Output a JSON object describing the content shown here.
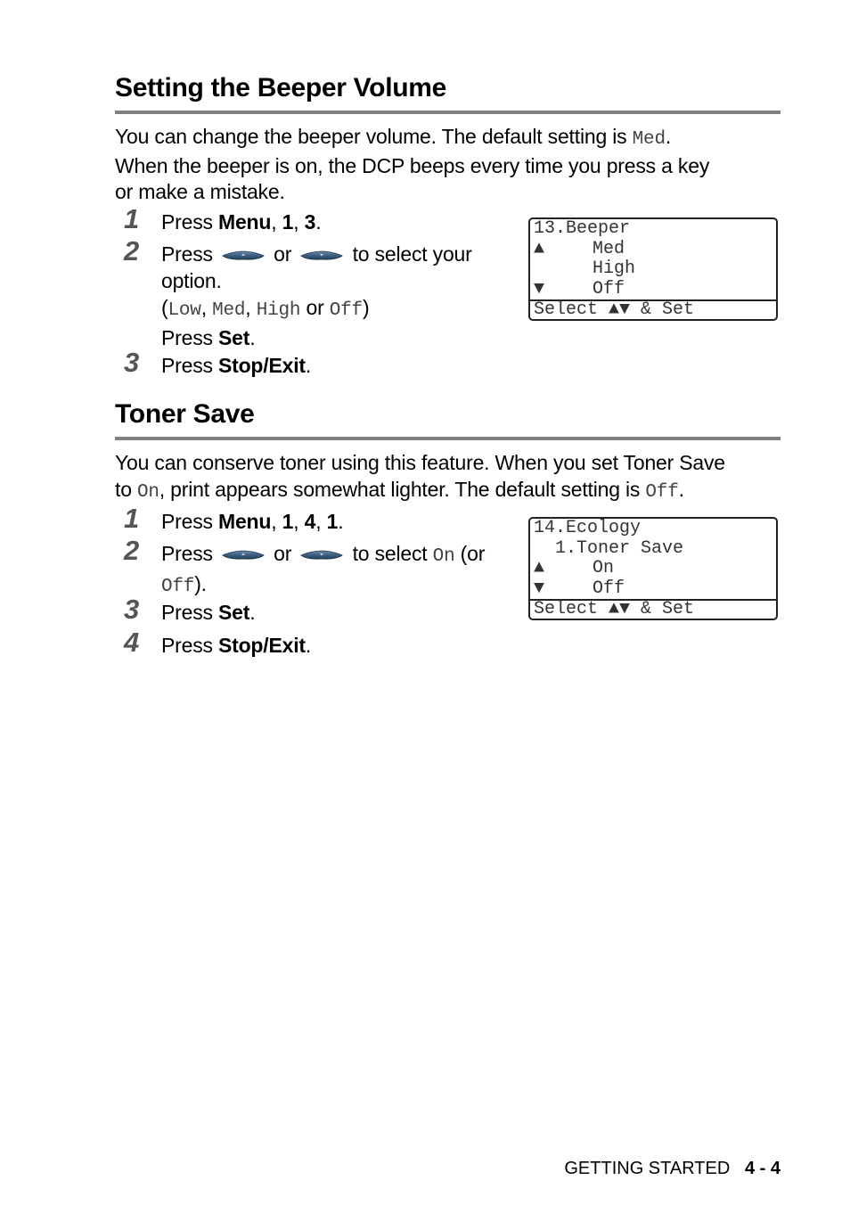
{
  "beeper_section": {
    "title": "Setting the Beeper Volume",
    "intro_1": "You can change the beeper volume. The default setting is ",
    "intro_default": "Med",
    "intro_2": ".",
    "intro_line2": "When the beeper is on, the DCP beeps every time you press a key",
    "intro_line3": "or make a mistake.",
    "steps": [
      {
        "num": "1",
        "press": "Press ",
        "keys": [
          "Menu",
          "1",
          "3"
        ]
      },
      {
        "num": "2",
        "press": "Press ",
        "or": " or ",
        "after": " to select your",
        "line2": "option.",
        "options": [
          "Low",
          "Med",
          "High",
          "Off"
        ],
        "sep": ", ",
        "or_word": " or ",
        "line4_press": "Press ",
        "line4_key": "Set"
      },
      {
        "num": "3",
        "press": "Press ",
        "key": "Stop/Exit"
      }
    ],
    "lcd": {
      "title": "13.Beeper",
      "rows": [
        {
          "arrow": "▲",
          "text": "Med"
        },
        {
          "arrow": "",
          "text": "High"
        },
        {
          "arrow": "▼",
          "text": "Off"
        }
      ],
      "footer": "Select ▲▼ & Set"
    }
  },
  "toner_section": {
    "title": "Toner Save",
    "intro_line1": "You can conserve toner using this feature. When you set Toner Save",
    "intro_to": "to ",
    "intro_on": "On",
    "intro_mid": ", print appears somewhat lighter. The default setting is ",
    "intro_default": "Off",
    "intro_end": ".",
    "steps": [
      {
        "num": "1",
        "press": "Press ",
        "keys": [
          "Menu",
          "1",
          "4",
          "1"
        ]
      },
      {
        "num": "2",
        "press": "Press ",
        "or": " or ",
        "after": " to select ",
        "value": "On",
        "paren_open": " (or",
        "alt": "Off",
        "paren_close": ")."
      },
      {
        "num": "3",
        "press": "Press ",
        "key": "Set"
      },
      {
        "num": "4",
        "press": "Press ",
        "key": "Stop/Exit"
      }
    ],
    "lcd": {
      "title": "14.Ecology",
      "subtitle": "  1.Toner Save",
      "rows": [
        {
          "arrow": "▲",
          "text": "On"
        },
        {
          "arrow": "▼",
          "text": "Off"
        }
      ],
      "footer": "Select ▲▼ & Set"
    }
  },
  "icons": {
    "up_button": "up-arrow-key-icon",
    "down_button": "down-arrow-key-icon"
  },
  "colors": {
    "key_button": "#3d5f80",
    "rule": "#808080",
    "step_number": "#555555"
  },
  "footer": {
    "section": "GETTING STARTED",
    "page": "4 - 4"
  }
}
